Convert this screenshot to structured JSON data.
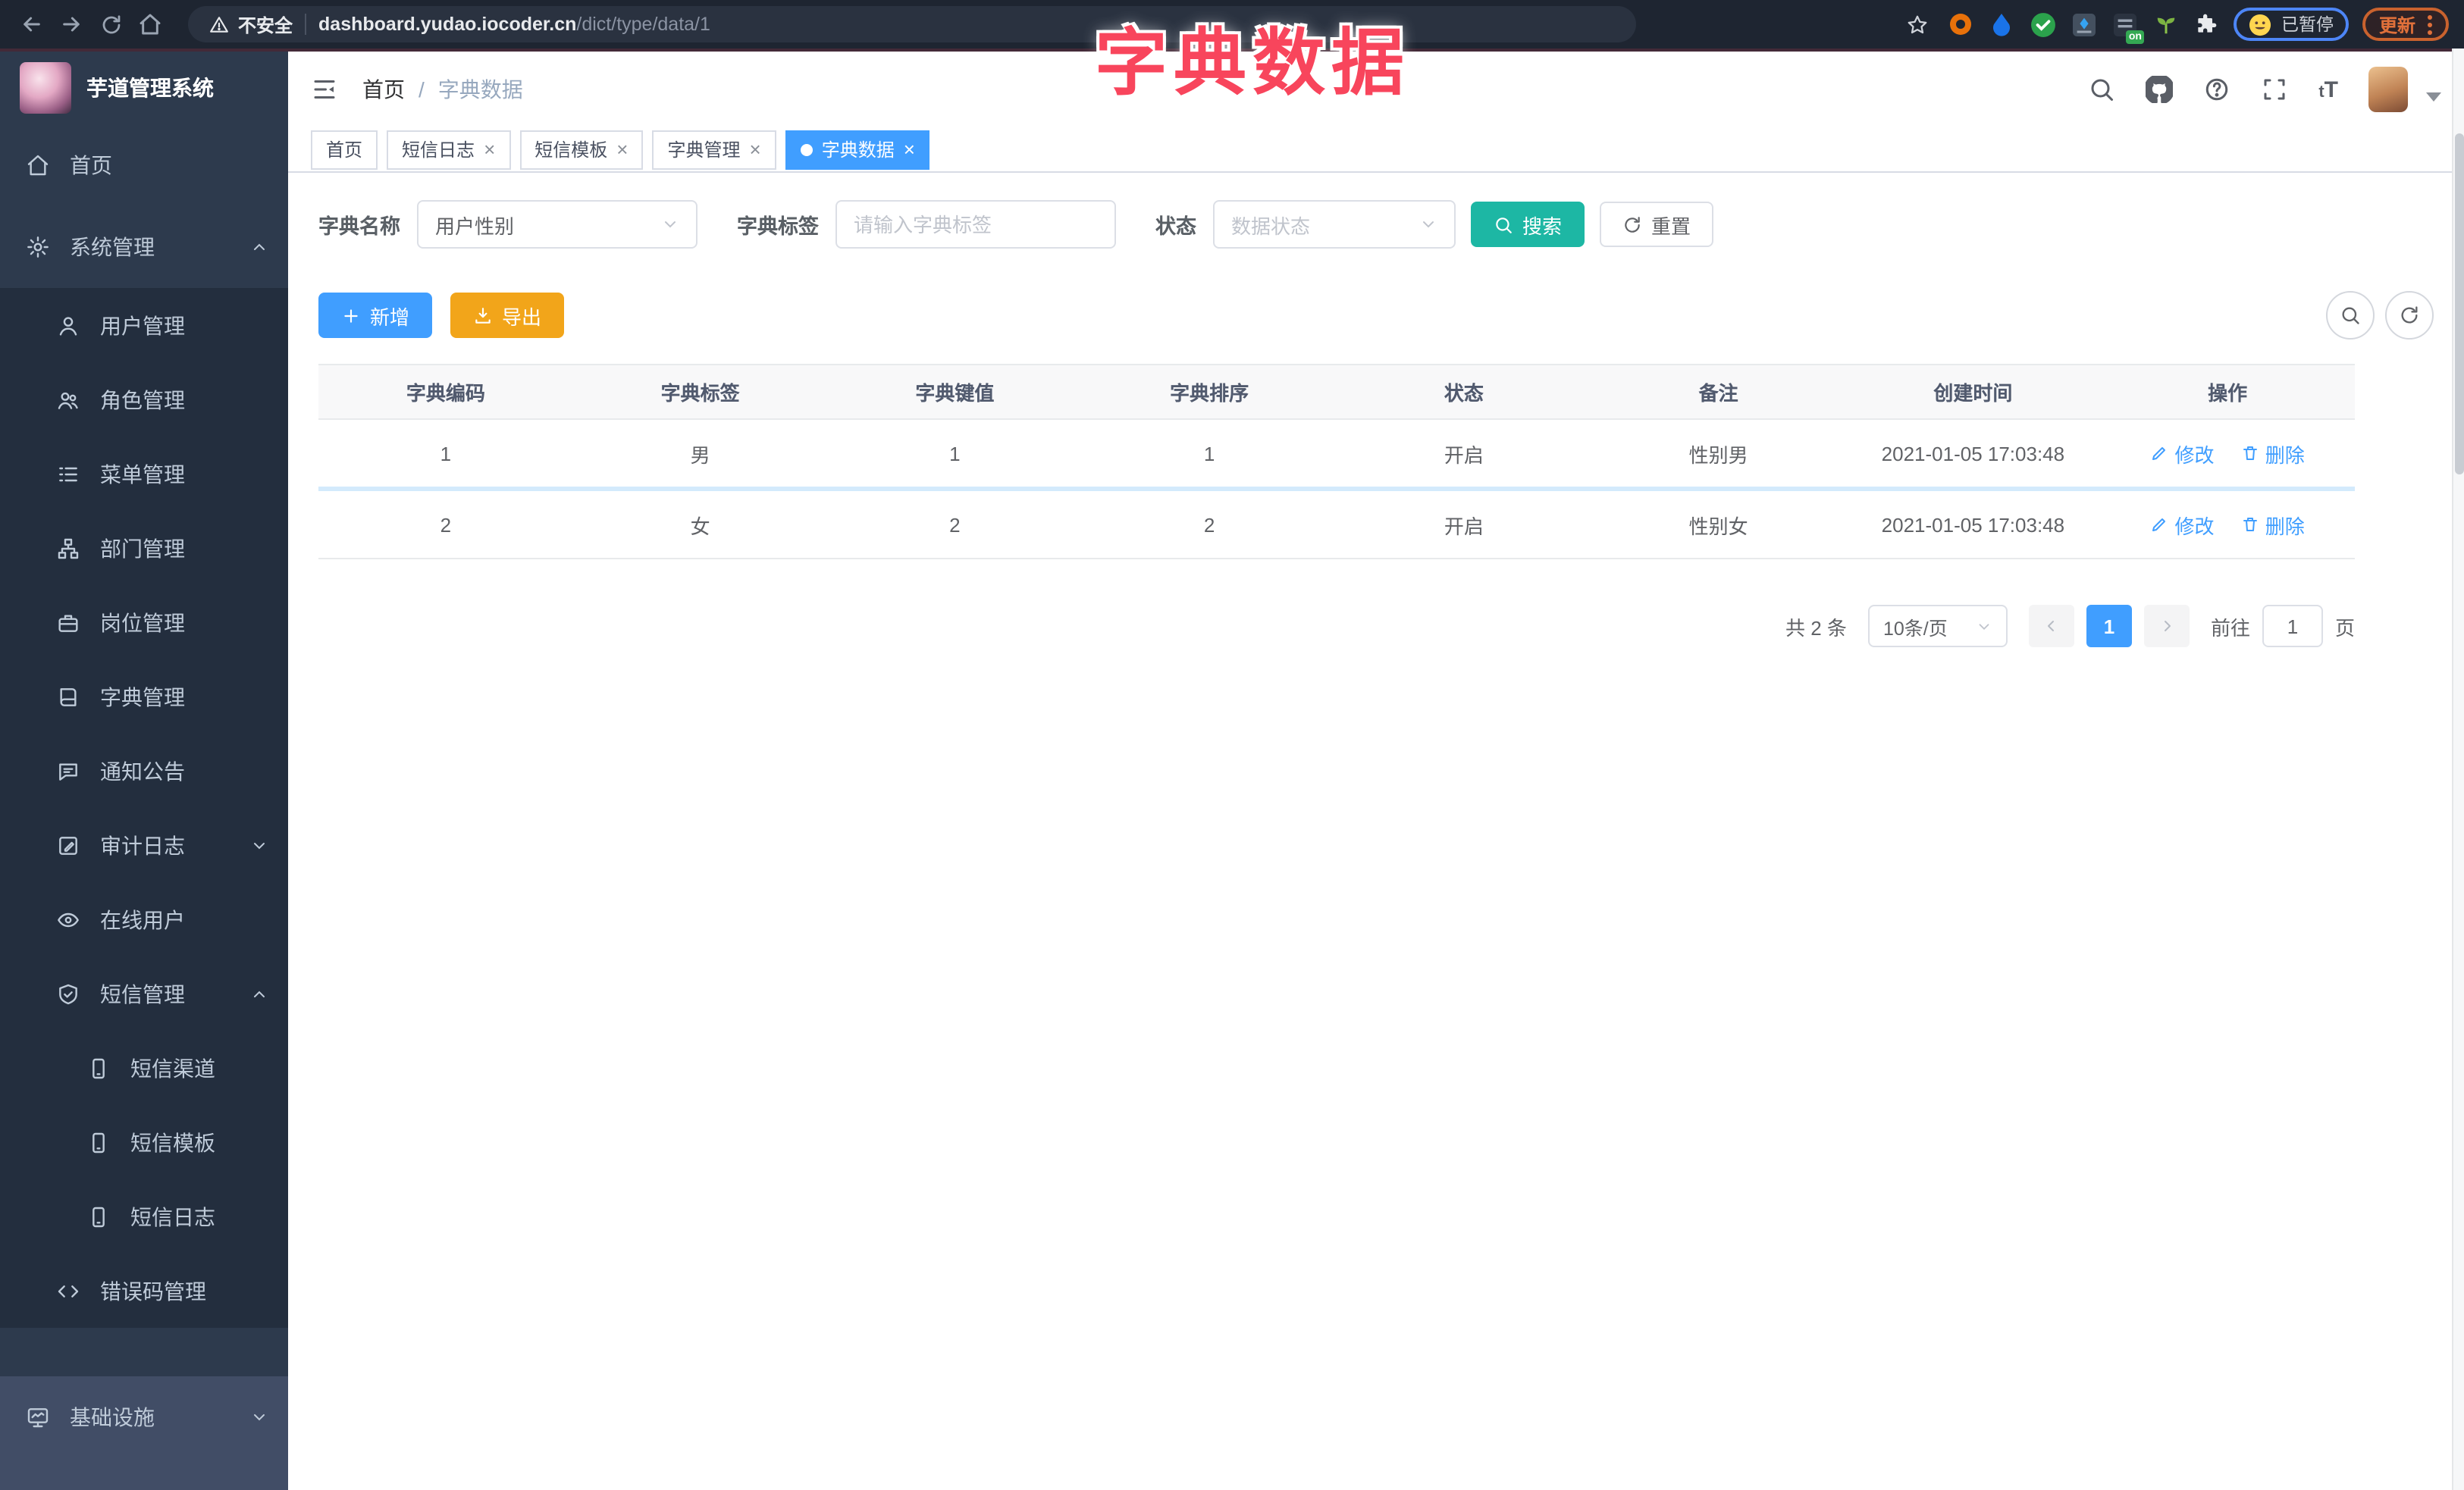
{
  "browser": {
    "security_label": "不安全",
    "url_host": "dashboard.yudao.iocoder.cn",
    "url_path": "/dict/type/data/1",
    "ext_on_badge": "on",
    "paused_label": "已暂停",
    "update_label": "更新"
  },
  "overlay_title": "字典数据",
  "sidebar": {
    "logo_title": "芋道管理系统",
    "items": [
      {
        "label": "首页",
        "icon": "home-icon"
      },
      {
        "label": "系统管理",
        "icon": "gear-icon",
        "chevron": "up"
      },
      {
        "label": "用户管理",
        "icon": "user-icon"
      },
      {
        "label": "角色管理",
        "icon": "users-icon"
      },
      {
        "label": "菜单管理",
        "icon": "menu-list-icon"
      },
      {
        "label": "部门管理",
        "icon": "org-tree-icon"
      },
      {
        "label": "岗位管理",
        "icon": "briefcase-icon"
      },
      {
        "label": "字典管理",
        "icon": "book-icon"
      },
      {
        "label": "通知公告",
        "icon": "megaphone-icon"
      },
      {
        "label": "审计日志",
        "icon": "edit-square-icon",
        "chevron": "down"
      },
      {
        "label": "在线用户",
        "icon": "online-users-icon"
      },
      {
        "label": "短信管理",
        "icon": "shield-check-icon",
        "chevron": "up"
      },
      {
        "label": "短信渠道",
        "icon": "phone-icon"
      },
      {
        "label": "短信模板",
        "icon": "phone-icon"
      },
      {
        "label": "短信日志",
        "icon": "phone-icon"
      },
      {
        "label": "错误码管理",
        "icon": "code-icon"
      },
      {
        "label": "基础设施",
        "icon": "monitor-icon",
        "chevron": "down"
      }
    ]
  },
  "navbar": {
    "breadcrumb_home": "首页",
    "breadcrumb_separator": "/",
    "breadcrumb_current": "字典数据"
  },
  "tabs": [
    {
      "label": "首页",
      "closable": false,
      "active": false
    },
    {
      "label": "短信日志",
      "closable": true,
      "active": false
    },
    {
      "label": "短信模板",
      "closable": true,
      "active": false
    },
    {
      "label": "字典管理",
      "closable": true,
      "active": false
    },
    {
      "label": "字典数据",
      "closable": true,
      "active": true
    }
  ],
  "tab_close_glyph": "×",
  "filters": {
    "name_label": "字典名称",
    "name_value": "用户性别",
    "tag_label": "字典标签",
    "tag_placeholder": "请输入字典标签",
    "status_label": "状态",
    "status_placeholder": "数据状态",
    "search_label": "搜索",
    "reset_label": "重置"
  },
  "toolbar": {
    "add_label": "新增",
    "export_label": "导出"
  },
  "table": {
    "columns": [
      "字典编码",
      "字典标签",
      "字典键值",
      "字典排序",
      "状态",
      "备注",
      "创建时间",
      "操作"
    ],
    "rows": [
      {
        "code": "1",
        "label": "男",
        "value": "1",
        "sort": "1",
        "status": "开启",
        "remark": "性别男",
        "created": "2021-01-05 17:03:48"
      },
      {
        "code": "2",
        "label": "女",
        "value": "2",
        "sort": "2",
        "status": "开启",
        "remark": "性别女",
        "created": "2021-01-05 17:03:48"
      }
    ],
    "edit_label": "修改",
    "delete_label": "删除"
  },
  "pagination": {
    "total_label": "共 2 条",
    "page_size_label": "10条/页",
    "current_page": "1",
    "goto_label": "前往",
    "goto_value": "1",
    "page_unit": "页"
  },
  "colors": {
    "accent_blue": "#409eff",
    "search_teal": "#1db7a4",
    "export_orange": "#f2a51a",
    "overlay_pink": "#f8455c",
    "sidebar_bg": "#2d3a4d",
    "submenu_bg": "#232e3e"
  }
}
